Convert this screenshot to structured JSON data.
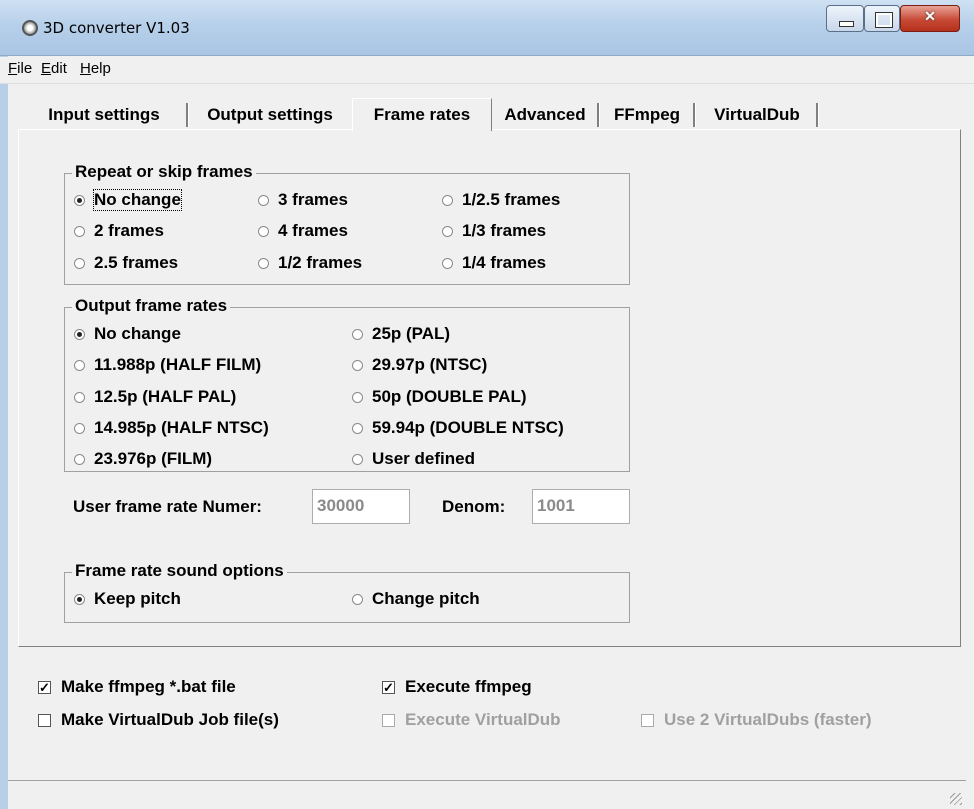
{
  "window": {
    "title": "3D converter V1.03",
    "icon": "app-gear-icon"
  },
  "menu": [
    {
      "label_u": "F",
      "label_rest": "ile"
    },
    {
      "label_u": "E",
      "label_rest": "dit"
    },
    {
      "label_u": "H",
      "label_rest": "elp"
    }
  ],
  "tabs": [
    "Input settings",
    "Output settings",
    "Frame rates",
    "Advanced",
    "FFmpeg",
    "VirtualDub"
  ],
  "active_tab": "Frame rates",
  "repeat_group": {
    "title": "Repeat or skip frames",
    "options": [
      "No change",
      "3 frames",
      "1/2.5 frames",
      "2 frames",
      "4 frames",
      "1/3 frames",
      "2.5 frames",
      "1/2 frames",
      "1/4 frames"
    ],
    "selected": "No change"
  },
  "output_group": {
    "title": "Output frame rates",
    "options": [
      "No change",
      "25p (PAL)",
      "11.988p (HALF FILM)",
      "29.97p (NTSC)",
      "12.5p (HALF PAL)",
      "50p (DOUBLE PAL)",
      "14.985p (HALF NTSC)",
      "59.94p (DOUBLE NTSC)",
      "23.976p (FILM)",
      "User defined"
    ],
    "selected": "No change"
  },
  "user_rate": {
    "numer_label": "User frame rate Numer:",
    "numer_value": "30000",
    "denom_label": "Denom:",
    "denom_value": "1001"
  },
  "sound_group": {
    "title": "Frame rate sound options",
    "options": [
      "Keep pitch",
      "Change pitch"
    ],
    "selected": "Keep pitch"
  },
  "checks": {
    "make_bat": {
      "label": "Make ffmpeg *.bat file",
      "checked": true
    },
    "exec_ffmpeg": {
      "label": "Execute ffmpeg",
      "checked": true
    },
    "make_vdub": {
      "label": "Make VirtualDub Job file(s)",
      "checked": false
    },
    "exec_vdub": {
      "label": "Execute VirtualDub",
      "checked": false,
      "disabled": true
    },
    "two_vdub": {
      "label": "Use 2 VirtualDubs (faster)",
      "checked": false,
      "disabled": true
    }
  }
}
